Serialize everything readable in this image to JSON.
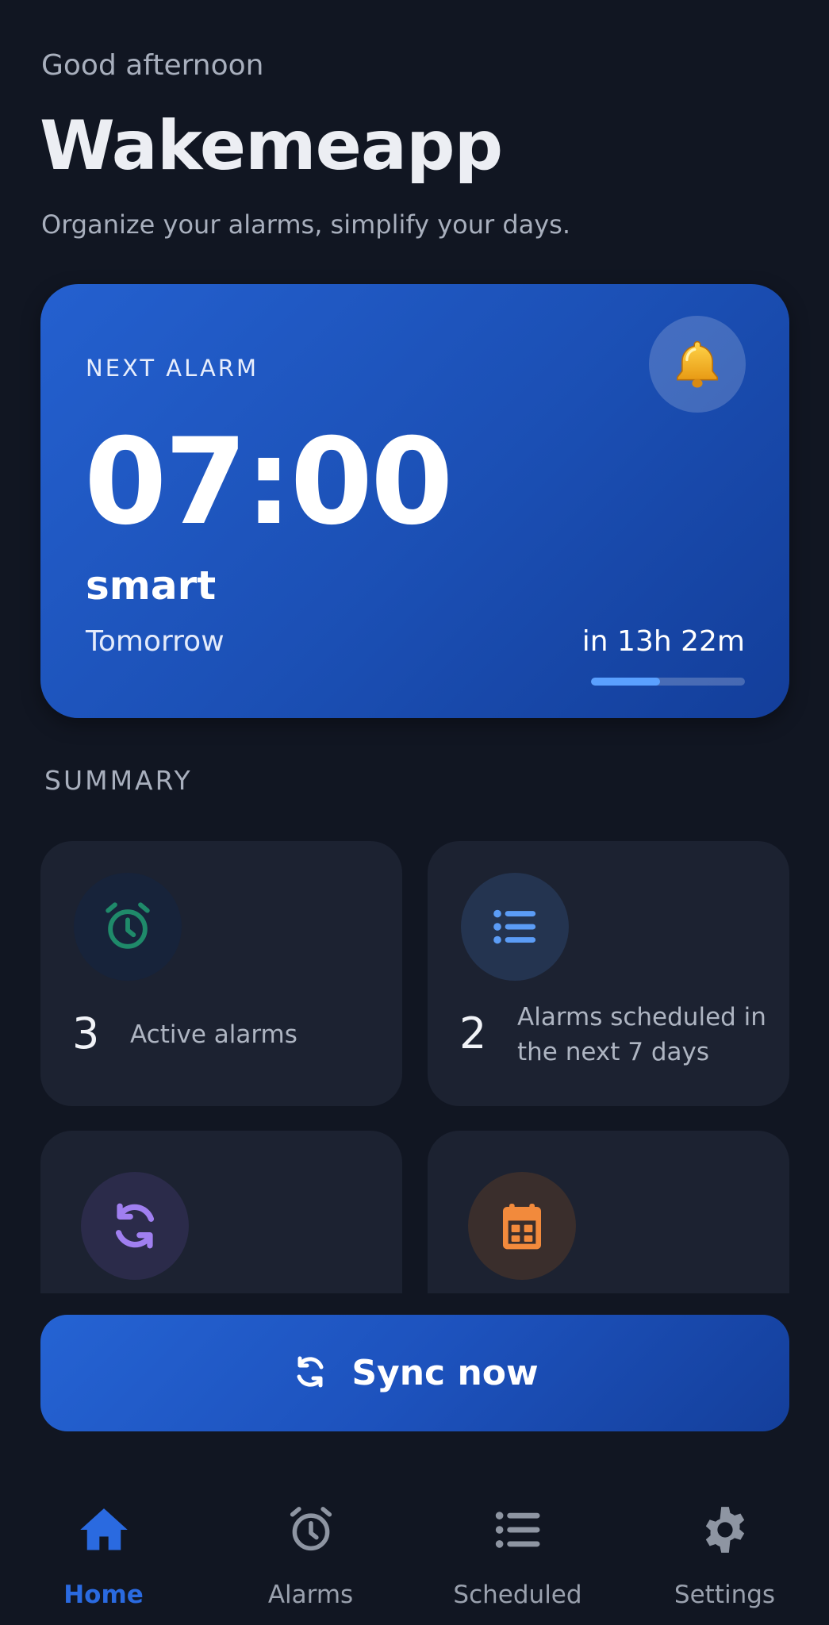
{
  "header": {
    "greeting": "Good afternoon",
    "app_name": "Wakemeapp",
    "tagline": "Organize your alarms, simplify your days."
  },
  "next_alarm": {
    "label": "NEXT ALARM",
    "time": "07:00",
    "name": "smart",
    "day": "Tomorrow",
    "countdown": "in 13h 22m",
    "progress_fraction": 0.45,
    "icon": "bell-icon"
  },
  "summary": {
    "title": "SUMMARY",
    "cards": [
      {
        "value": "3",
        "description": "Active alarms",
        "icon": "alarm-clock-icon",
        "color": "#1f8a6a"
      },
      {
        "value": "2",
        "description": "Alarms scheduled in the next 7 days",
        "icon": "list-icon",
        "color": "#5b9cf6"
      },
      {
        "value": "",
        "description": "",
        "icon": "sync-icon",
        "color": "#a07ff0"
      },
      {
        "value": "",
        "description": "",
        "icon": "calendar-icon",
        "color": "#f28a3c"
      }
    ]
  },
  "sync_button": {
    "label": "Sync now",
    "icon": "sync-icon"
  },
  "nav": {
    "items": [
      {
        "label": "Home",
        "icon": "home-icon",
        "active": true
      },
      {
        "label": "Alarms",
        "icon": "alarm-clock-icon",
        "active": false
      },
      {
        "label": "Scheduled",
        "icon": "list-icon",
        "active": false
      },
      {
        "label": "Settings",
        "icon": "gear-icon",
        "active": false
      }
    ]
  },
  "colors": {
    "background": "#111622",
    "card": "#1c2231",
    "accent": "#2a6ae0",
    "progress": "#5aa0ff"
  }
}
